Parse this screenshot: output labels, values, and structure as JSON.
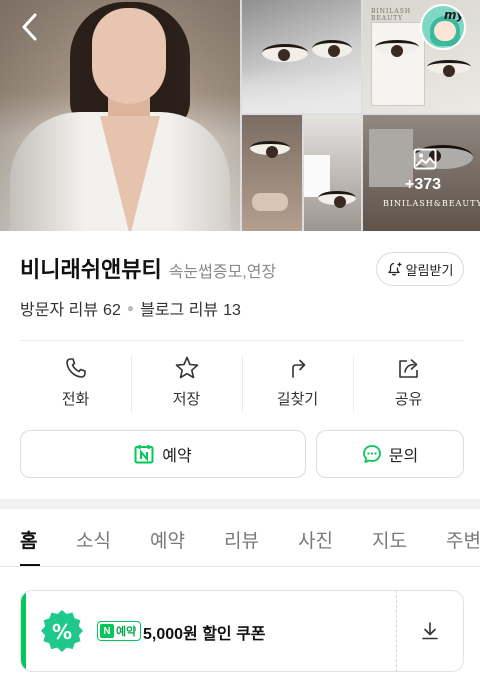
{
  "header": {
    "my_badge_label": "my",
    "photo_count": "+373",
    "brand_watermark": "BINILASH&BEAUTY",
    "brand_watermark_top": "BINILASH BEAUTY"
  },
  "place": {
    "name": "비니래쉬앤뷰티",
    "category": "속눈썹증모,연장",
    "alarm_label": "알림받기"
  },
  "reviews": {
    "visitor_label": "방문자 리뷰",
    "visitor_count": "62",
    "blog_label": "블로그 리뷰",
    "blog_count": "13"
  },
  "actions": [
    {
      "label": "전화",
      "icon": "phone-icon"
    },
    {
      "label": "저장",
      "icon": "star-icon"
    },
    {
      "label": "길찾기",
      "icon": "directions-icon"
    },
    {
      "label": "공유",
      "icon": "share-icon"
    }
  ],
  "buttons": {
    "reserve_label": "예약",
    "inquiry_label": "문의"
  },
  "tabs": [
    "홈",
    "소식",
    "예약",
    "리뷰",
    "사진",
    "지도",
    "주변"
  ],
  "active_tab": "홈",
  "coupon": {
    "tag_label": "예약",
    "tag_n": "N",
    "text": "5,000원 할인 쿠폰",
    "badge_symbol": "%"
  },
  "colors": {
    "brand_green": "#03c75a"
  }
}
